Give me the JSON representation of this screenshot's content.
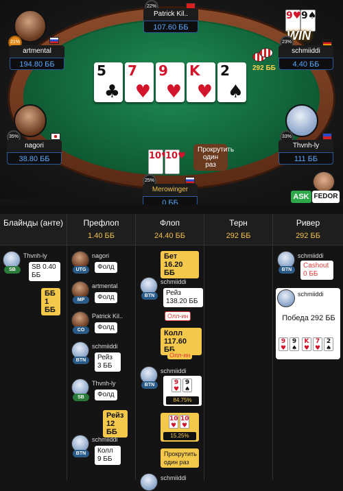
{
  "table": {
    "board": [
      {
        "rank": "5",
        "suit": "♣",
        "color": "blk"
      },
      {
        "rank": "7",
        "suit": "♥",
        "color": "red"
      },
      {
        "rank": "9",
        "suit": "♥",
        "color": "red"
      },
      {
        "rank": "K",
        "suit": "♥",
        "color": "red"
      },
      {
        "rank": "2",
        "suit": "♠",
        "color": "blk"
      }
    ],
    "pot": "292 ББ",
    "win_label": "WIN",
    "hero_bubble": "Прокрутить один раз"
  },
  "players": {
    "artmental": {
      "name": "artmental",
      "stack": "194.80 ББ",
      "pct": "21%"
    },
    "patrick": {
      "name": "Patrick Kil..",
      "stack": "107.60 ББ",
      "pct": "22%"
    },
    "schmiiddi": {
      "name": "schmiiddi",
      "stack": "4.40 ББ",
      "pct": "23%",
      "cards": [
        "9♥",
        "9♠"
      ]
    },
    "nagori": {
      "name": "nagori",
      "stack": "38.80 ББ",
      "pct": "35%"
    },
    "thvnh": {
      "name": "Thvnh-ly",
      "stack": "111 ББ",
      "pct": "33%"
    },
    "merowinger": {
      "name": "Merowinger",
      "stack": "0 ББ",
      "pct": "25%",
      "cards": [
        "10♥",
        "10♥"
      ]
    }
  },
  "buttons": {
    "ask": "ASK",
    "fedor": "FEDOR"
  },
  "history": {
    "columns": [
      {
        "title": "Блайнды (анте)",
        "value": ""
      },
      {
        "title": "Префлоп",
        "value": "1.40 ББ"
      },
      {
        "title": "Флоп",
        "value": "24.40 ББ"
      },
      {
        "title": "Терн",
        "value": "292 ББ"
      },
      {
        "title": "Ривер",
        "value": "292 ББ"
      }
    ],
    "blinds": [
      {
        "name": "Thvnh-ly",
        "pos": "SB",
        "action": "SB 0.40 ББ"
      },
      {
        "name": "",
        "pos": "",
        "action": "ББ 1 ББ"
      }
    ],
    "preflop": [
      {
        "name": "nagori",
        "pos": "UTG",
        "action": "Фолд"
      },
      {
        "name": "artmental",
        "pos": "MP",
        "action": "Фолд"
      },
      {
        "name": "Patrick Kil..",
        "pos": "CO",
        "action": "Фолд"
      },
      {
        "name": "schmiiddi",
        "pos": "BTN",
        "action": "Рейз 3 ББ"
      },
      {
        "name": "Thvnh-ly",
        "pos": "SB",
        "action": "Фолд"
      },
      {
        "name": "",
        "pos": "",
        "action": "Рейз 12 ББ"
      },
      {
        "name": "schmiiddi",
        "pos": "BTN",
        "action": "Колл 9 ББ"
      }
    ],
    "flop": {
      "bet": "Бет 16.20 ББ",
      "raise_name": "schmiiddi",
      "raise_pos": "BTN",
      "raise": "Рейз 138.20 ББ",
      "raise_tag": "Олл-ин",
      "call": "Колл 117.60 ББ",
      "call_tag": "Олл-ин",
      "show_name": "schmiiddi",
      "show_pos": "BTN",
      "equity1": "84.75%",
      "equity2": "15.25%",
      "runit": "Прокрутить один раз",
      "last_name": "schmiiddi"
    },
    "river": {
      "cashout_name": "schmiiddi",
      "cashout_pos": "BTN",
      "cashout": "Cashout 0 ББ",
      "win_name": "schmiiddi",
      "win_text": "Победа 292 ББ",
      "win_cards": [
        "9♥",
        "9♠",
        "K♥",
        "7♥",
        "2♠"
      ]
    }
  }
}
